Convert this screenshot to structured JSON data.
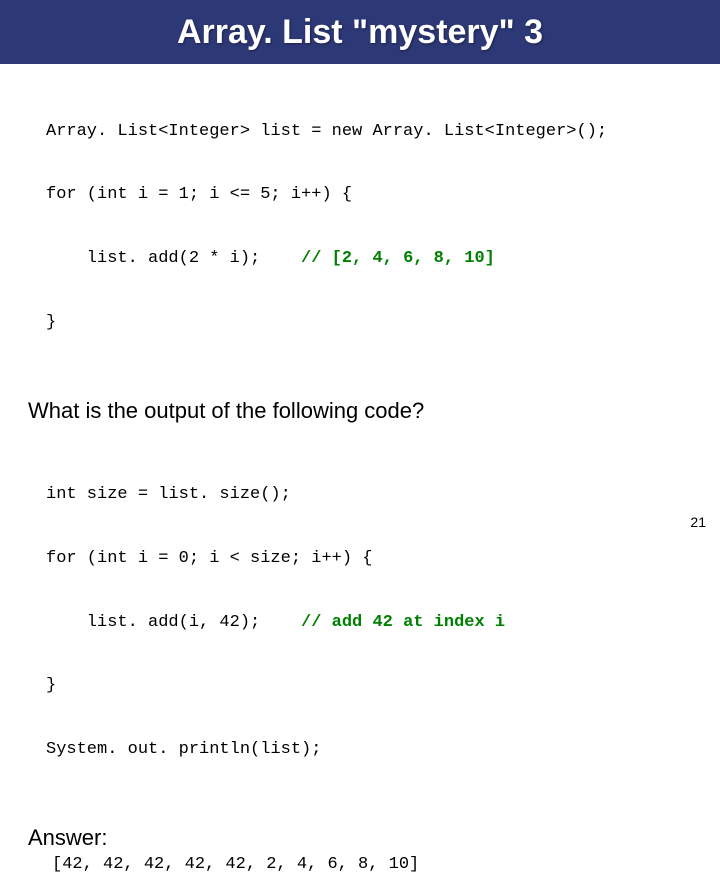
{
  "title": "Array. List \"mystery\" 3",
  "code1": {
    "l1": "Array. List<Integer> list = new Array. List<Integer>();",
    "l2": "for (int i = 1; i <= 5; i++) {",
    "l3a": "    list. add(2 * i);    ",
    "l3b": "// [2, 4, 6, 8, 10]",
    "l4": "}"
  },
  "question": "What is the output of the following code?",
  "code2": {
    "l1": "int size = list. size();",
    "l2": "for (int i = 0; i < size; i++) {",
    "l3a": "    list. add(i, 42);    ",
    "l3b": "// add 42 at index i",
    "l4": "}",
    "l5": "System. out. println(list);"
  },
  "answer_label": "Answer:",
  "answer_value": "[42, 42, 42, 42, 42, 2, 4, 6, 8, 10]",
  "page_number": "21"
}
